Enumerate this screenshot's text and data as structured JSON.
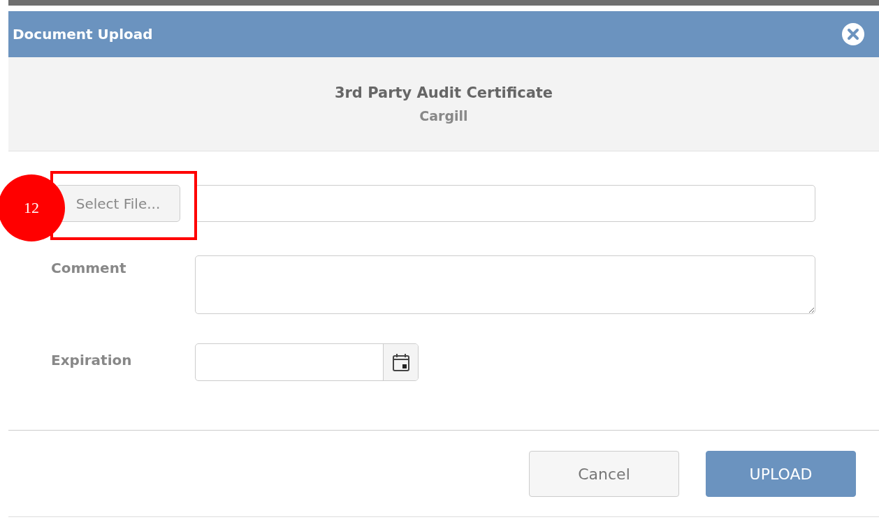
{
  "dialog": {
    "title": "Document Upload",
    "document": "3rd Party Audit Certificate",
    "company": "Cargill",
    "select_file": "Select File...",
    "fields": [
      {
        "kind": "textarea",
        "label": "Comment"
      },
      {
        "kind": "date",
        "label": "Expiration"
      }
    ],
    "buttons": [
      {
        "label": "Cancel",
        "kind": "secondary"
      },
      {
        "label": "UPLOAD",
        "kind": "primary"
      }
    ]
  },
  "annotation": {
    "number": "12"
  }
}
